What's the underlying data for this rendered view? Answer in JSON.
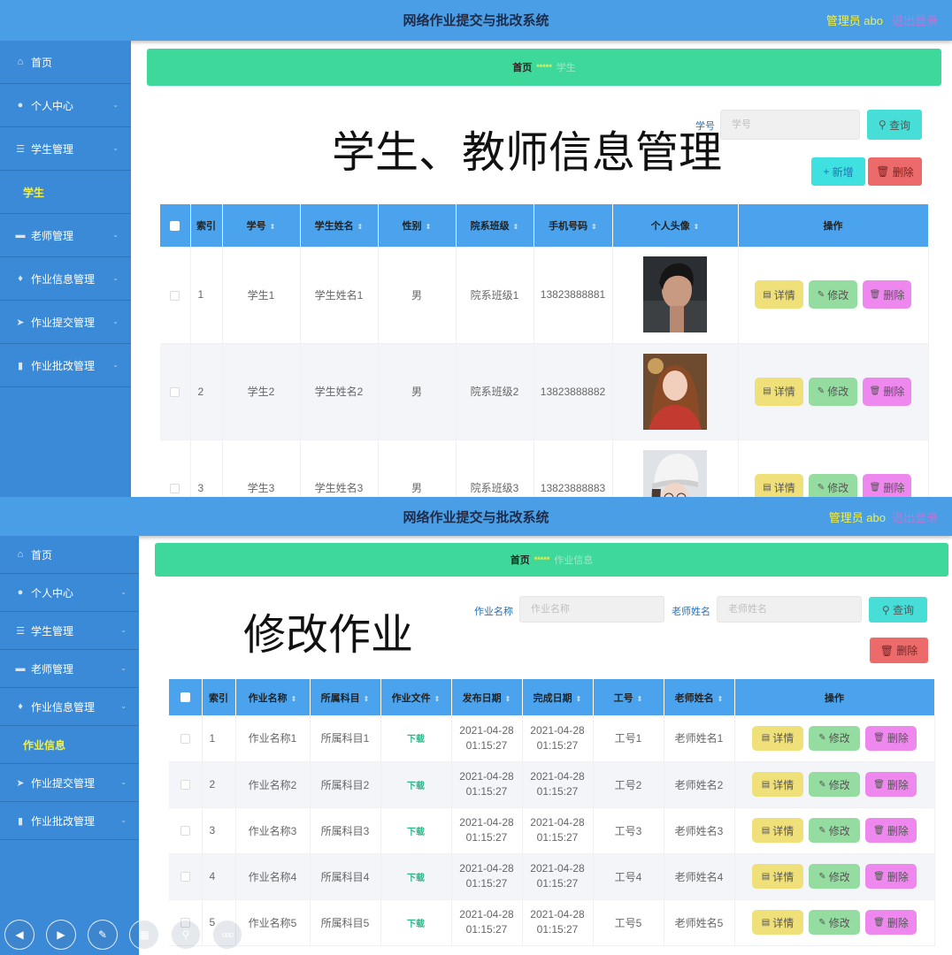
{
  "app": {
    "title": "网络作业提交与批改系统",
    "user": "管理员 abo",
    "logout": "退出登录"
  },
  "panel1": {
    "menu": [
      {
        "icon": "home-icon",
        "glyph": "⌂",
        "label": "首页",
        "chevron": false
      },
      {
        "icon": "user-icon",
        "glyph": "●",
        "label": "个人中心",
        "chevron": true
      },
      {
        "icon": "list-icon",
        "glyph": "☰",
        "label": "学生管理",
        "chevron": true
      },
      {
        "icon": "",
        "glyph": "",
        "label": "学生",
        "chevron": false,
        "sub": true
      },
      {
        "icon": "book-icon",
        "glyph": "▬",
        "label": "老师管理",
        "chevron": true
      },
      {
        "icon": "bulb-icon",
        "glyph": "♦",
        "label": "作业信息管理",
        "chevron": true
      },
      {
        "icon": "send-icon",
        "glyph": "➤",
        "label": "作业提交管理",
        "chevron": true
      },
      {
        "icon": "chart-icon",
        "glyph": "▮",
        "label": "作业批改管理",
        "chevron": true
      }
    ],
    "breadcrumb": {
      "home": "首页",
      "sep": "*****",
      "current": "学生"
    },
    "overlay": "学生、教师信息管理",
    "search": {
      "label": "学号",
      "placeholder": "学号",
      "button": "查询"
    },
    "add_label": "新增",
    "delete_label": "删除",
    "columns": [
      "",
      "索引",
      "学号",
      "学生姓名",
      "性别",
      "院系班级",
      "手机号码",
      "个人头像",
      "操作"
    ],
    "rows": [
      {
        "idx": "1",
        "no": "学生1",
        "name": "学生姓名1",
        "sex": "男",
        "cls": "院系班级1",
        "phone": "13823888881",
        "avatar": "avatar-male"
      },
      {
        "idx": "2",
        "no": "学生2",
        "name": "学生姓名2",
        "sex": "男",
        "cls": "院系班级2",
        "phone": "13823888882",
        "avatar": "avatar-girl-red"
      },
      {
        "idx": "3",
        "no": "学生3",
        "name": "学生姓名3",
        "sex": "男",
        "cls": "院系班级3",
        "phone": "13823888883",
        "avatar": "avatar-girl-cap"
      }
    ],
    "actions": {
      "detail": "详情",
      "edit": "修改",
      "delete": "删除"
    }
  },
  "panel2": {
    "menu": [
      {
        "icon": "home-icon",
        "glyph": "⌂",
        "label": "首页",
        "chevron": false
      },
      {
        "icon": "user-icon",
        "glyph": "●",
        "label": "个人中心",
        "chevron": true
      },
      {
        "icon": "list-icon",
        "glyph": "☰",
        "label": "学生管理",
        "chevron": true
      },
      {
        "icon": "book-icon",
        "glyph": "▬",
        "label": "老师管理",
        "chevron": true
      },
      {
        "icon": "bulb-icon",
        "glyph": "♦",
        "label": "作业信息管理",
        "chevron": true
      },
      {
        "icon": "",
        "glyph": "",
        "label": "作业信息",
        "chevron": false,
        "sub": true
      },
      {
        "icon": "send-icon",
        "glyph": "➤",
        "label": "作业提交管理",
        "chevron": true
      },
      {
        "icon": "chart-icon",
        "glyph": "▮",
        "label": "作业批改管理",
        "chevron": true
      }
    ],
    "breadcrumb": {
      "home": "首页",
      "sep": "*****",
      "current": "作业信息"
    },
    "overlay": "修改作业",
    "search": {
      "name_label": "作业名称",
      "name_placeholder": "作业名称",
      "teacher_label": "老师姓名",
      "teacher_placeholder": "老师姓名",
      "button": "查询"
    },
    "delete_label": "删除",
    "columns": [
      "",
      "索引",
      "作业名称",
      "所属科目",
      "作业文件",
      "发布日期",
      "完成日期",
      "工号",
      "老师姓名",
      "操作"
    ],
    "rows": [
      {
        "idx": "1",
        "name": "作业名称1",
        "subject": "所属科目1",
        "file": "下载",
        "pub_d": "2021-04-28",
        "pub_t": "01:15:27",
        "fin_d": "2021-04-28",
        "fin_t": "01:15:27",
        "no": "工号1",
        "teacher": "老师姓名1"
      },
      {
        "idx": "2",
        "name": "作业名称2",
        "subject": "所属科目2",
        "file": "下载",
        "pub_d": "2021-04-28",
        "pub_t": "01:15:27",
        "fin_d": "2021-04-28",
        "fin_t": "01:15:27",
        "no": "工号2",
        "teacher": "老师姓名2"
      },
      {
        "idx": "3",
        "name": "作业名称3",
        "subject": "所属科目3",
        "file": "下载",
        "pub_d": "2021-04-28",
        "pub_t": "01:15:27",
        "fin_d": "2021-04-28",
        "fin_t": "01:15:27",
        "no": "工号3",
        "teacher": "老师姓名3"
      },
      {
        "idx": "4",
        "name": "作业名称4",
        "subject": "所属科目4",
        "file": "下载",
        "pub_d": "2021-04-28",
        "pub_t": "01:15:27",
        "fin_d": "2021-04-28",
        "fin_t": "01:15:27",
        "no": "工号4",
        "teacher": "老师姓名4"
      },
      {
        "idx": "5",
        "name": "作业名称5",
        "subject": "所属科目5",
        "file": "下载",
        "pub_d": "2021-04-28",
        "pub_t": "01:15:27",
        "fin_d": "2021-04-28",
        "fin_t": "01:15:27",
        "no": "工号5",
        "teacher": "老师姓名5"
      }
    ],
    "actions": {
      "detail": "详情",
      "edit": "修改",
      "delete": "删除"
    }
  },
  "float_toolbar": [
    {
      "icon": "back-icon",
      "glyph": "◀"
    },
    {
      "icon": "forward-icon",
      "glyph": "▶"
    },
    {
      "icon": "pen-icon",
      "glyph": "✎"
    },
    {
      "icon": "grid-icon",
      "glyph": "▦"
    },
    {
      "icon": "zoom-icon",
      "glyph": "⚲"
    },
    {
      "icon": "more-icon",
      "glyph": "ooo"
    }
  ],
  "colors": {
    "topbar": "#4a9ee6",
    "sidebar": "#3a8ad8",
    "breadcrumb": "#3ed99a",
    "table_header": "#4aa3ec",
    "active_menu": "#f1ef4a"
  }
}
